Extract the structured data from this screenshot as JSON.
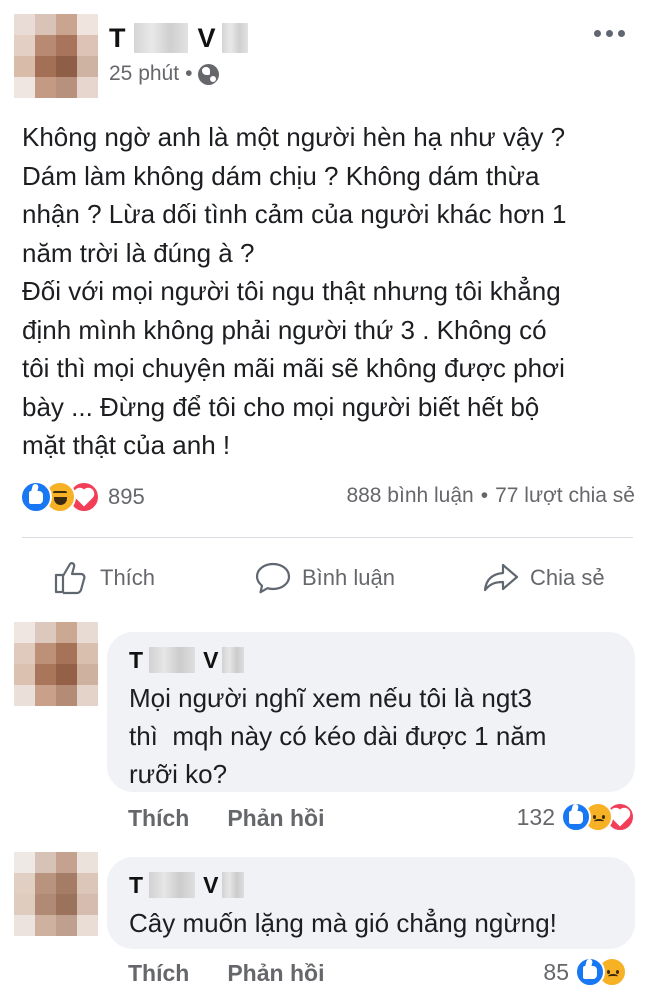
{
  "post": {
    "author": {
      "first_letter": "T",
      "last_letter": "V"
    },
    "time": "25 phút",
    "separator": "•",
    "icons": {
      "privacy": "globe-icon",
      "more": "more-options-icon"
    },
    "text_lines": [
      "Không ngờ anh là một người hèn hạ như vậy ?",
      "Dám làm không dám chịu ? Không dám thừa",
      "nhận ? Lừa dối tình cảm của người khác hơn 1",
      "năm trời là đúng à ?",
      "Đối với mọi người tôi ngu thật nhưng tôi khẳng",
      "định mình không phải người thứ 3 . Không có",
      "tôi thì mọi chuyện mãi mãi sẽ không được phơi",
      "bày ... Đừng để tôi cho mọi người biết hết bộ",
      "mặt thật của anh !"
    ],
    "reactions": {
      "types": [
        "like",
        "haha",
        "love"
      ],
      "count": "895"
    },
    "stats": {
      "comments": "888 bình luận",
      "separator": "•",
      "shares": "77 lượt chia sẻ"
    },
    "actions": {
      "like": "Thích",
      "comment": "Bình luận",
      "share": "Chia sẻ"
    }
  },
  "comments": [
    {
      "author": {
        "first_letter": "T",
        "last_letter": "V"
      },
      "text": "Mọi người nghĩ xem nếu tôi là ngt3\nthì  mqh này có kéo dài được 1 năm\nrưỡi ko?",
      "like_label": "Thích",
      "reply_label": "Phản hồi",
      "reaction_count": "132",
      "reaction_types": [
        "like",
        "sad",
        "love"
      ]
    },
    {
      "author": {
        "first_letter": "T",
        "last_letter": "V"
      },
      "text": "Cây muốn lặng mà gió chẳng ngừng!",
      "like_label": "Thích",
      "reply_label": "Phản hồi",
      "reaction_count": "85",
      "reaction_types": [
        "like",
        "sad"
      ]
    }
  ],
  "colors": {
    "like_blue": "#1877f2",
    "haha_yellow": "#f7b125",
    "love_red": "#f33e58",
    "secondary_text": "#65676b",
    "bubble_bg": "#f0f2f5"
  }
}
